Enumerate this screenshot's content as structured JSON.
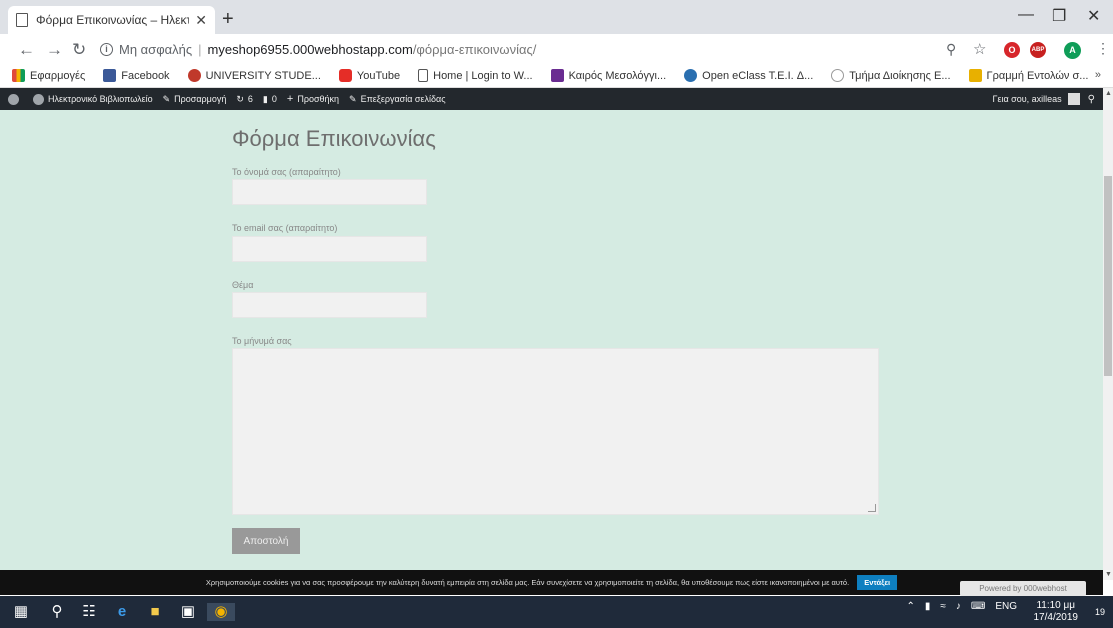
{
  "browser": {
    "tab_title": "Φόρμα Επικοινωνίας – Ηλεκτρο",
    "tab_close": "✕",
    "new_tab": "+",
    "omnibox": {
      "security": "Μη ασφαλής",
      "host": "myeshop6955.000webhostapp.com",
      "path": "/φόρμα-επικοινωνίας/"
    },
    "bookmarks": [
      {
        "label": "Εφαρμογές",
        "color": "#e04a3a"
      },
      {
        "label": "Facebook",
        "color": "#3b5998"
      },
      {
        "label": "UNIVERSITY STUDE...",
        "color": "#c0392b"
      },
      {
        "label": "YouTube",
        "color": "#e52d27"
      },
      {
        "label": "Home | Login to W...",
        "color": "#888888"
      },
      {
        "label": "Καιρός Μεσολόγγι...",
        "color": "#6a2c91"
      },
      {
        "label": "Open eClass T.E.I. Δ...",
        "color": "#2a6fb0"
      },
      {
        "label": "Τμήμα Διοίκησης Ε...",
        "color": "#aaaaaa"
      },
      {
        "label": "Γραμμή Εντολών σ...",
        "color": "#e8b000"
      }
    ],
    "bookmarks_more": "»",
    "profile_letter": "A",
    "abp": "ABP"
  },
  "adminbar": {
    "site": "Ηλεκτρονικό Βιβλιοπωλείο",
    "customize": "Προσαρμογή",
    "updates": "6",
    "comments": "0",
    "new": "Προσθήκη",
    "edit": "Επεξεργασία σελίδας",
    "greeting": "Γεια σου, axilleas"
  },
  "form": {
    "title": "Φόρμα Επικοινωνίας",
    "name_label": "Το όνομά σας (απαραίτητο)",
    "email_label": "Το email σας (απαραίτητο)",
    "subject_label": "Θέμα",
    "message_label": "Το μήνυμά σας",
    "submit": "Αποστολή"
  },
  "cookie": {
    "text": "Χρησιμοποιούμε cookies για να σας προσφέρουμε την καλύτερη δυνατή εμπειρία στη σελίδα μας. Εάν συνεχίσετε να χρησιμοποιείτε τη σελίδα, θα υποθέσουμε πως είστε ικανοποιημένοι με αυτό.",
    "accept": "Εντάξει",
    "powered": "Powered by 000webhost"
  },
  "taskbar": {
    "lang": "ENG",
    "time": "11:10 μμ",
    "date": "17/4/2019",
    "notifications": "19"
  }
}
